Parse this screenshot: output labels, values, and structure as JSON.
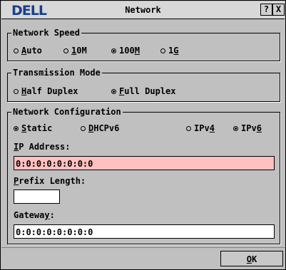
{
  "window": {
    "title": "Network",
    "help_label": "?",
    "close_label": "X"
  },
  "brand": {
    "logo_text": "DELL"
  },
  "network_speed": {
    "legend": "Network Speed",
    "options": [
      {
        "label_pre": "",
        "label_u": "A",
        "label_post": "uto",
        "selected": false
      },
      {
        "label_pre": "",
        "label_u": "1",
        "label_post": "0M",
        "selected": false
      },
      {
        "label_pre": "100",
        "label_u": "M",
        "label_post": "",
        "selected": true
      },
      {
        "label_pre": "1",
        "label_u": "G",
        "label_post": "",
        "selected": false
      }
    ]
  },
  "transmission_mode": {
    "legend": "Transmission Mode",
    "options": [
      {
        "label_pre": "",
        "label_u": "H",
        "label_post": "alf Duplex",
        "selected": false
      },
      {
        "label_pre": "",
        "label_u": "F",
        "label_post": "ull Duplex",
        "selected": true
      }
    ]
  },
  "network_configuration": {
    "legend": "Network Configuration",
    "modes": [
      {
        "label_pre": "",
        "label_u": "S",
        "label_post": "tatic",
        "selected": true
      },
      {
        "label_pre": "",
        "label_u": "D",
        "label_post": "HCPv6",
        "selected": false
      }
    ],
    "ip_versions": [
      {
        "label_pre": "IPv",
        "label_u": "4",
        "label_post": "",
        "selected": false
      },
      {
        "label_pre": "IPv",
        "label_u": "6",
        "label_post": "",
        "selected": true
      }
    ],
    "ip_address": {
      "label_u": "I",
      "label_post": "P Address:",
      "value": "0:0:0:0:0:0:0:0"
    },
    "prefix_length": {
      "label_u": "P",
      "label_post": "refix Length:",
      "value": ""
    },
    "gateway": {
      "label_pre": "Gatewa",
      "label_u": "y",
      "label_post": ":",
      "value": "0:0:0:0:0:0:0:0"
    }
  },
  "footer": {
    "ok_u": "O",
    "ok_post": "K"
  }
}
